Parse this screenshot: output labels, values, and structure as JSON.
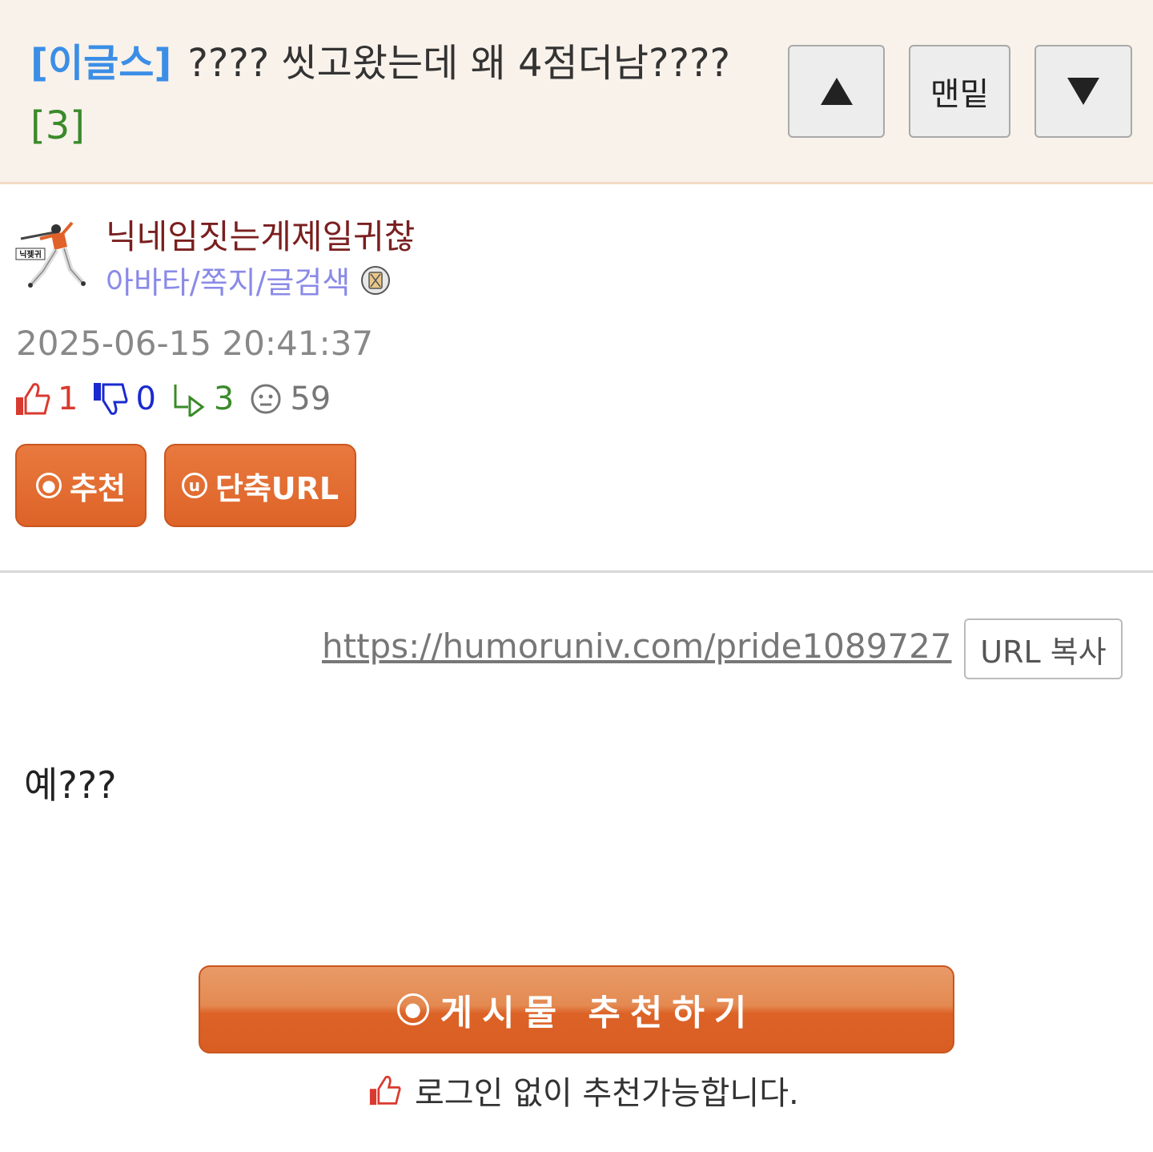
{
  "header": {
    "category": "[이글스]",
    "title": "???? 씻고왔는데 왜 4점더남????",
    "comment_count": "[3]",
    "nav": {
      "bottom_label": "맨밑"
    }
  },
  "author": {
    "nickname": "닉네임짓는게제일귀찮",
    "links": "아바타/쪽지/글검색",
    "avatar_caption": "닉젲귀"
  },
  "post": {
    "date": "2025-06-15 20:41:37",
    "stats": {
      "up": "1",
      "down": "0",
      "replies": "3",
      "views": "59"
    },
    "buttons": {
      "recommend": "추천",
      "short_url": "단축URL"
    },
    "url": "https://humoruniv.com/pride1089727",
    "url_copy": "URL 복사",
    "content": "예???"
  },
  "footer": {
    "recommend_button": "게시물 추천하기",
    "login_note": "로그인 없이 추천가능합니다."
  },
  "colors": {
    "header_bg": "#f9f2eb",
    "category": "#3b8ee6",
    "comment_count": "#3a8a2a",
    "nickname": "#7a1f1f",
    "author_links": "#8a8ae8",
    "accent_orange": "#de6328",
    "up": "#d93a2f",
    "down": "#1a2ad0"
  }
}
